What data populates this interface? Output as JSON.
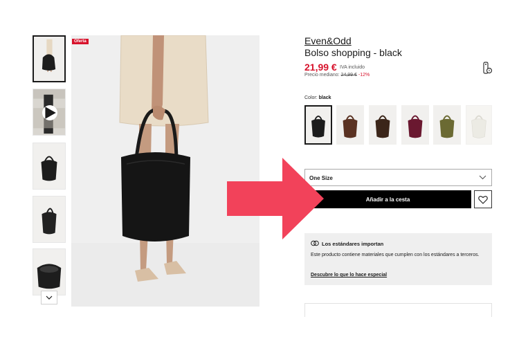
{
  "gallery": {
    "badge": "Oferta",
    "thumbnails": [
      "thumb-model-front",
      "thumb-video",
      "thumb-bag-front",
      "thumb-bag-side",
      "thumb-bag-inside"
    ],
    "scroll_icon": "chevron-down-icon",
    "play_icon": "play-icon"
  },
  "product": {
    "brand": "Even&Odd",
    "name": "Bolso shopping - black",
    "price": "21,99 €",
    "vat_note": "IVA incluido",
    "median_label": "Precio mediano:",
    "median_old_price": "24,99 €",
    "median_discount": "-12%",
    "info_icon": "info-tag-icon"
  },
  "colors": {
    "label": "Color:",
    "selected": "black",
    "swatches": [
      {
        "name": "black",
        "hex": "#1c1c1c"
      },
      {
        "name": "brown",
        "hex": "#5a3222"
      },
      {
        "name": "dark-brown",
        "hex": "#3b2519"
      },
      {
        "name": "burgundy",
        "hex": "#6a1830"
      },
      {
        "name": "olive",
        "hex": "#6b6a33"
      },
      {
        "name": "cream",
        "hex": "#ecebe4"
      }
    ]
  },
  "size": {
    "value": "One Size",
    "icon": "chevron-down-icon"
  },
  "actions": {
    "add_to_cart": "Añadir a la cesta",
    "wishlist_icon": "heart-icon"
  },
  "standards": {
    "icon": "standards-icon",
    "title": "Los estándares importan",
    "body": "Este producto contiene materiales que cumplen con los estándares a terceros.",
    "link": "Descubre lo que lo hace especial"
  },
  "colors_theme": {
    "accent": "#d7132c",
    "arrow": "#f2425a",
    "button": "#000000"
  }
}
